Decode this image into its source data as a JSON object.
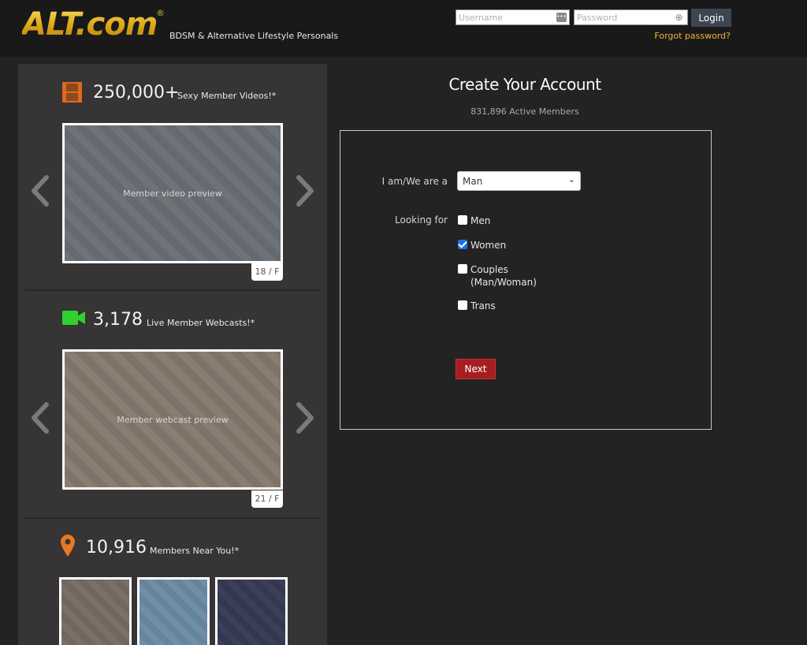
{
  "header": {
    "logo_text": "ALT.com",
    "logo_registered": "®",
    "tagline": "BDSM & Alternative Lifestyle Personals",
    "username_placeholder": "Username",
    "password_placeholder": "Password",
    "login_label": "Login",
    "forgot_password": "Forgot password?"
  },
  "sidebar": {
    "videos": {
      "icon": "film-icon",
      "count": "250,000+",
      "label": "Sexy Member Videos!*",
      "media_alt": "Member video preview",
      "badge": "18 / F"
    },
    "webcasts": {
      "icon": "video-camera-icon",
      "count": "3,178",
      "label": "Live Member Webcasts!*",
      "media_alt": "Member webcast preview",
      "badge": "21 / F"
    },
    "nearby": {
      "icon": "map-pin-icon",
      "count": "10,916",
      "label": "Members Near You!*",
      "thumbnails": [
        "Member photo 1",
        "Member photo 2",
        "Member photo 3"
      ]
    },
    "prev_arrow": "‹",
    "next_arrow": "›"
  },
  "main": {
    "title": "Create Your Account",
    "subtitle": "831,896 Active Members",
    "form": {
      "iam_label": "I am/We are a",
      "iam_value": "Man",
      "looking_label": "Looking for",
      "options": [
        {
          "label": "Men",
          "checked": false
        },
        {
          "label": "Women",
          "checked": true
        },
        {
          "label": "Couples",
          "label2": "(Man/Woman)",
          "checked": false
        },
        {
          "label": "Trans",
          "checked": false
        }
      ],
      "next_label": "Next"
    }
  },
  "colors": {
    "accent_gold": "#e8b82a",
    "forgot_link": "#f0b43c",
    "next_button": "#a71e22",
    "login_button": "#3c4550",
    "checkbox_checked": "#1a73e8",
    "film_icon": "#e06a1e",
    "camera_icon": "#2fd12f",
    "pin_icon": "#e87722"
  }
}
